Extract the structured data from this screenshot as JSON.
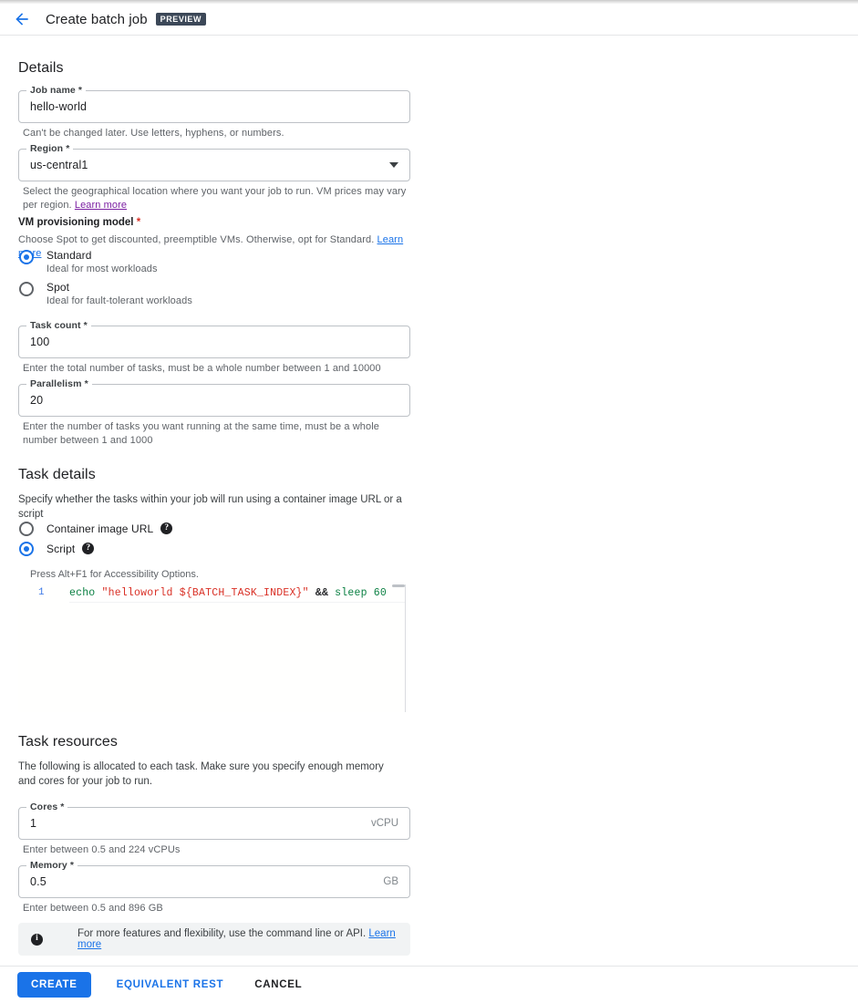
{
  "header": {
    "back_icon": "arrow-back-icon",
    "title": "Create batch job",
    "badge": "PREVIEW"
  },
  "details": {
    "section_title": "Details",
    "job_name": {
      "label": "Job name *",
      "value": "hello-world",
      "helper": "Can't be changed later. Use letters, hyphens, or numbers."
    },
    "region": {
      "label": "Region *",
      "value": "us-central1",
      "helper_prefix": "Select the geographical location where you want your job to run. VM prices may vary per region. ",
      "helper_link": "Learn more"
    },
    "provisioning": {
      "label": "VM provisioning model ",
      "required_mark": "*",
      "description": "Choose Spot to get discounted, preemptible VMs. Otherwise, opt for Standard. ",
      "description_link": "Learn more",
      "options": [
        {
          "label": "Standard",
          "sub": "Ideal for most workloads",
          "selected": true
        },
        {
          "label": "Spot",
          "sub": "Ideal for fault-tolerant workloads",
          "selected": false
        }
      ]
    },
    "task_count": {
      "label": "Task count *",
      "value": "100",
      "helper": "Enter the total number of tasks, must be a whole number between 1 and 10000"
    },
    "parallelism": {
      "label": "Parallelism *",
      "value": "20",
      "helper": "Enter the number of tasks you want running at the same time, must be a whole number between 1 and 1000"
    }
  },
  "task_details": {
    "section_title": "Task details",
    "description": "Specify whether the tasks within your job will run using a container image URL or a script",
    "options": [
      {
        "label": "Container image URL",
        "selected": false,
        "help_icon": "help-icon"
      },
      {
        "label": "Script",
        "selected": true,
        "help_icon": "help-icon"
      }
    ],
    "editor": {
      "accessibility_hint": "Press Alt+F1 for Accessibility Options.",
      "line_number": "1",
      "code_tokens": [
        {
          "text": "echo ",
          "type": "keyword"
        },
        {
          "text": "\"helloworld ${BATCH_TASK_INDEX}\"",
          "type": "string"
        },
        {
          "text": " && ",
          "type": "operator"
        },
        {
          "text": "sleep ",
          "type": "keyword"
        },
        {
          "text": "60",
          "type": "number"
        }
      ],
      "code_plain": "echo \"helloworld ${BATCH_TASK_INDEX}\" && sleep 60"
    }
  },
  "task_resources": {
    "section_title": "Task resources",
    "description": "The following is allocated to each task. Make sure you specify enough memory and cores for your job to run.",
    "cores": {
      "label": "Cores *",
      "value": "1",
      "suffix": "vCPU",
      "helper": "Enter between 0.5 and 224 vCPUs"
    },
    "memory": {
      "label": "Memory *",
      "value": "0.5",
      "suffix": "GB",
      "helper": "Enter between 0.5 and 896 GB"
    }
  },
  "banner": {
    "icon": "info-icon",
    "text_prefix": "For more features and flexibility, use the command line or API. ",
    "link": "Learn more"
  },
  "footer": {
    "create": "CREATE",
    "equivalent_rest": "EQUIVALENT REST",
    "cancel": "CANCEL"
  },
  "colors": {
    "accent": "#1a73e8",
    "badge_bg": "#3c4858",
    "required": "#d93025",
    "visited_link": "#7b1fa2",
    "banner_bg": "#f1f3f4"
  }
}
